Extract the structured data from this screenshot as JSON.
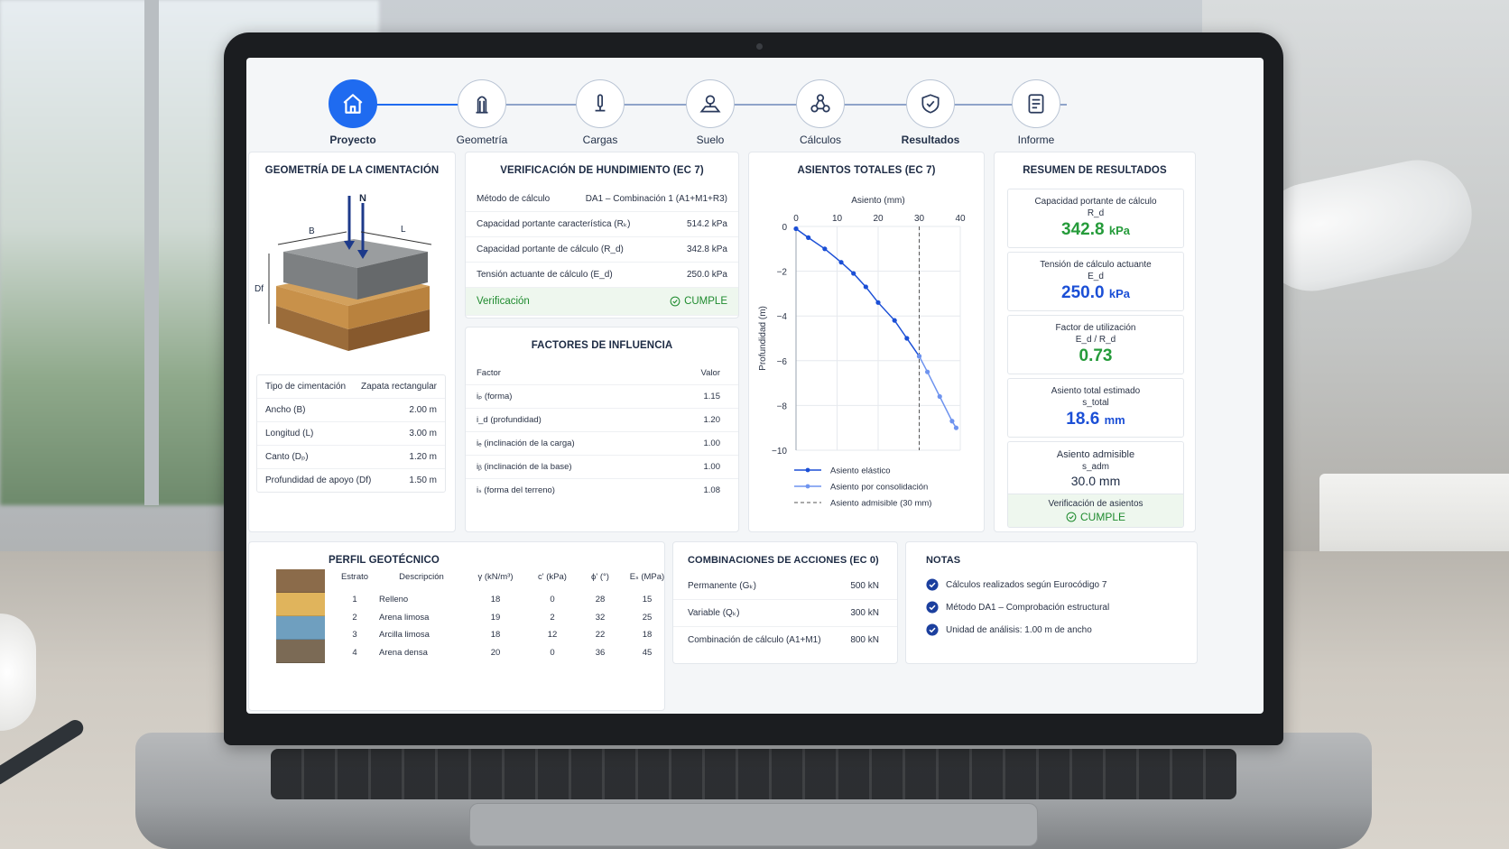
{
  "steps": [
    {
      "label": "Proyecto",
      "icon": "home-icon"
    },
    {
      "label": "Geometría",
      "icon": "column-icon"
    },
    {
      "label": "Cargas",
      "icon": "load-arrow-icon"
    },
    {
      "label": "Suelo",
      "icon": "map-pin-icon"
    },
    {
      "label": "Cálculos",
      "icon": "nodes-icon"
    },
    {
      "label": "Resultados",
      "icon": "shield-check-icon"
    },
    {
      "label": "Informe",
      "icon": "document-icon"
    }
  ],
  "geometry": {
    "title": "GEOMETRÍA DE LA CIMENTACIÓN",
    "labels": {
      "n": "N",
      "b": "B",
      "l": "L",
      "df": "Df"
    },
    "rows": [
      {
        "k": "Tipo de cimentación",
        "v": "Zapata rectangular"
      },
      {
        "k": "Ancho (B)",
        "v": "2.00 m"
      },
      {
        "k": "Longitud (L)",
        "v": "3.00 m"
      },
      {
        "k": "Canto (Dₚ)",
        "v": "1.20 m"
      },
      {
        "k": "Profundidad de apoyo (Df)",
        "v": "1.50 m"
      }
    ]
  },
  "verification": {
    "title": "VERIFICACIÓN DE HUNDIMIENTO (EC 7)",
    "rows": [
      {
        "k": "Método de cálculo",
        "v": "DA1 – Combinación 1 (A1+M1+R3)"
      },
      {
        "k": "Capacidad portante característica (Rₖ)",
        "v": "514.2 kPa"
      },
      {
        "k": "Capacidad portante de cálculo (R_d)",
        "v": "342.8 kPa"
      },
      {
        "k": "Tensión actuante de cálculo (E_d)",
        "v": "250.0 kPa"
      }
    ],
    "result_label": "Verificación",
    "result_value": "CUMPLE"
  },
  "factors": {
    "title": "FACTORES DE INFLUENCIA",
    "head": {
      "k": "Factor",
      "v": "Valor"
    },
    "rows": [
      {
        "k": "iₚ (forma)",
        "v": "1.15"
      },
      {
        "k": "i_d (profundidad)",
        "v": "1.20"
      },
      {
        "k": "iₑ (inclinación de la carga)",
        "v": "1.00"
      },
      {
        "k": "iᵦ (inclinación de la base)",
        "v": "1.00"
      },
      {
        "k": "iₛ (forma del terreno)",
        "v": "1.08"
      }
    ]
  },
  "chart_data": {
    "type": "line",
    "title": "ASIENTOS TOTALES (EC 7)",
    "xlabel": "Asiento (mm)",
    "ylabel": "Profundidad (m)",
    "xlim": [
      0,
      40
    ],
    "ylim": [
      -10,
      0
    ],
    "x_ticks": [
      "0",
      "10",
      "20",
      "30",
      "40"
    ],
    "y_ticks": [
      "0",
      "−2",
      "−4",
      "−6",
      "−8",
      "−10"
    ],
    "series": [
      {
        "name": "Asiento elástico",
        "color": "#1b4fd6",
        "x": [
          0,
          3,
          7,
          11,
          14,
          17,
          20,
          24,
          27,
          30
        ],
        "y": [
          -0.1,
          -0.5,
          -1.0,
          -1.6,
          -2.1,
          -2.7,
          -3.4,
          -4.2,
          -5.0,
          -5.8
        ]
      },
      {
        "name": "Asiento por consolidación",
        "color": "#6f94ef",
        "x": [
          30,
          32,
          35,
          38,
          39
        ],
        "y": [
          -5.8,
          -6.5,
          -7.6,
          -8.7,
          -9.0
        ]
      }
    ],
    "reference_line": {
      "name": "Asiento admisible (30 mm)",
      "x": 30
    },
    "legend": "bottom"
  },
  "summary": {
    "title": "RESUMEN DE RESULTADOS",
    "items": [
      {
        "label": "Capacidad portante de cálculo",
        "sub": "R_d",
        "value": "342.8",
        "unit": "kPa",
        "color": "green"
      },
      {
        "label": "Tensión de cálculo actuante",
        "sub": "E_d",
        "value": "250.0",
        "unit": "kPa",
        "color": "blue"
      },
      {
        "label": "Factor de utilización",
        "sub": "E_d / R_d",
        "value": "0.73",
        "unit": "",
        "color": "green"
      },
      {
        "label": "Asiento total estimado",
        "sub": "s_total",
        "value": "18.6",
        "unit": "mm",
        "color": "blue"
      },
      {
        "label": "Asiento admisible",
        "sub": "s_adm",
        "value": "30.0 mm",
        "unit": "",
        "color": "dark"
      }
    ],
    "check_label": "Verificación de asientos",
    "check_value": "CUMPLE"
  },
  "profile": {
    "title": "PERFIL GEOTÉCNICO",
    "head": [
      "Estrato",
      "Descripción",
      "γ (kN/m³)",
      "c' (kPa)",
      "ϕ' (°)",
      "Eₛ (MPa)"
    ],
    "rows": [
      [
        "1",
        "Relleno",
        "18",
        "0",
        "28",
        "15"
      ],
      [
        "2",
        "Arena limosa",
        "19",
        "2",
        "32",
        "25"
      ],
      [
        "3",
        "Arcilla limosa",
        "18",
        "12",
        "22",
        "18"
      ],
      [
        "4",
        "Arena densa",
        "20",
        "0",
        "36",
        "45"
      ]
    ],
    "colors": [
      "#8b6b4a",
      "#e0b45c",
      "#6f9fbf",
      "#7b6a55"
    ]
  },
  "combinations": {
    "title": "COMBINACIONES DE ACCIONES (EC 0)",
    "rows": [
      {
        "k": "Permanente (Gₖ)",
        "v": "500 kN"
      },
      {
        "k": "Variable (Qₖ)",
        "v": "300 kN"
      },
      {
        "k": "Combinación de cálculo (A1+M1)",
        "v": "800 kN"
      }
    ]
  },
  "notes": {
    "title": "NOTAS",
    "items": [
      "Cálculos realizados según Eurocódigo 7",
      "Método DA1 – Comprobación estructural",
      "Unidad de análisis: 1.00 m de ancho"
    ]
  }
}
